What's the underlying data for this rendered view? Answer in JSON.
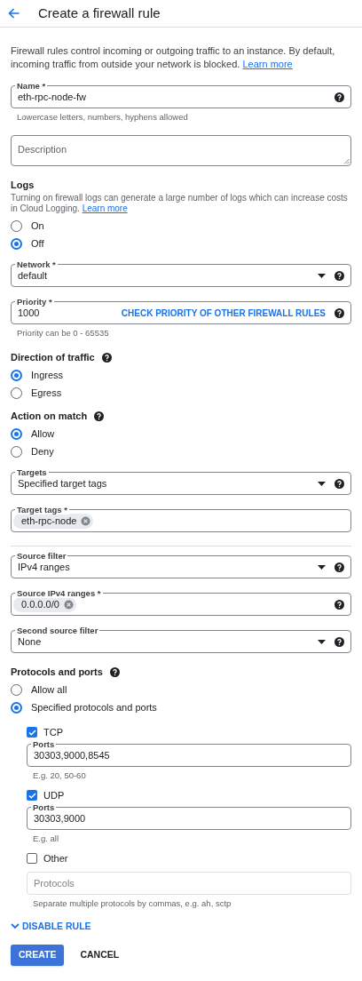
{
  "header": {
    "title": "Create a firewall rule"
  },
  "intro": {
    "text": "Firewall rules control incoming or outgoing traffic to an instance. By default, incoming traffic from outside your network is blocked.",
    "link": "Learn more"
  },
  "form": [
    {
      "kind": "field",
      "label": "Name *",
      "value": "eth-rpc-node-fw",
      "help": true,
      "hint": "Lowercase letters, numbers, hyphens allowed"
    },
    {
      "kind": "textarea",
      "placeholder": "Description"
    },
    {
      "kind": "radios",
      "heading": "Logs",
      "description": "Turning on firewall logs can generate a large number of logs which can increase costs in Cloud Logging.",
      "link": "Learn more",
      "options": [
        {
          "label": "On",
          "selected": false
        },
        {
          "label": "Off",
          "selected": true
        }
      ]
    },
    {
      "kind": "select",
      "label": "Network *",
      "value": "default",
      "help": true
    },
    {
      "kind": "field",
      "label": "Priority *",
      "value": "1000",
      "action": "CHECK PRIORITY OF OTHER FIREWALL RULES",
      "help": true,
      "hint": "Priority can be 0 - 65535"
    },
    {
      "kind": "radios",
      "heading": "Direction of traffic",
      "help": true,
      "options": [
        {
          "label": "Ingress",
          "selected": true
        },
        {
          "label": "Egress",
          "selected": false
        }
      ]
    },
    {
      "kind": "radios",
      "heading": "Action on match",
      "help": true,
      "options": [
        {
          "label": "Allow",
          "selected": true
        },
        {
          "label": "Deny",
          "selected": false
        }
      ]
    },
    {
      "kind": "select",
      "label": "Targets",
      "value": "Specified target tags",
      "help": true
    },
    {
      "kind": "chips",
      "label": "Target tags *",
      "chips": [
        "eth-rpc-node"
      ]
    },
    {
      "kind": "divider"
    },
    {
      "kind": "select",
      "label": "Source filter",
      "value": "IPv4 ranges",
      "help": true
    },
    {
      "kind": "chips",
      "label": "Source IPv4 ranges *",
      "chips": [
        "0.0.0.0/0"
      ],
      "help": true
    },
    {
      "kind": "select",
      "label": "Second source filter",
      "value": "None",
      "help": true
    },
    {
      "kind": "radios",
      "heading": "Protocols and ports",
      "help": true,
      "options": [
        {
          "label": "Allow all",
          "selected": false
        },
        {
          "label": "Specified protocols and ports",
          "selected": true
        }
      ],
      "protocols": [
        {
          "label": "TCP",
          "checked": true,
          "field": {
            "label": "Ports",
            "value": "30303,9000,8545",
            "hint": "E.g. 20, 50-60"
          }
        },
        {
          "label": "UDP",
          "checked": true,
          "field": {
            "label": "Ports",
            "value": "30303,9000",
            "hint": "E.g. all"
          }
        },
        {
          "label": "Other",
          "checked": false,
          "field": {
            "placeholder": "Protocols",
            "hint": "Separate multiple protocols by commas, e.g. ah, sctp"
          }
        }
      ]
    }
  ],
  "disable_rule": {
    "label": "DISABLE RULE"
  },
  "buttons": [
    {
      "label": "CREATE",
      "primary": true
    },
    {
      "label": "CANCEL",
      "primary": false
    }
  ]
}
